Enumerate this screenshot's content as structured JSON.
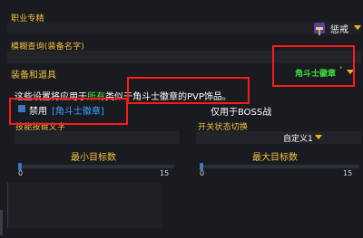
{
  "specialization": {
    "label": "职业专精",
    "value": "惩戒",
    "icon": "hammer-icon"
  },
  "fuzzy_search": {
    "label": "模糊查询(装备名字)",
    "value": ""
  },
  "equipment": {
    "label": "装备和道具",
    "selected": "角斗士徽章",
    "selected_color": "#3ee03e"
  },
  "description": {
    "part1": "这些设置将应用于",
    "highlight": "所有",
    "part2": "类似于角斗士徽章的PVP饰品。",
    "highlight_color": "#3ee03e"
  },
  "disable": {
    "label": "禁用",
    "item": "[角斗士徽章]",
    "item_color": "#3fa0ff"
  },
  "boss_only": {
    "label": "仅用于BOSS战"
  },
  "ability_text": {
    "label": "技能按键文字"
  },
  "toggle_switch": {
    "label": "开关状态切换",
    "value": "自定义1"
  },
  "min_targets": {
    "label": "最小目标数",
    "min": "0",
    "max": "15",
    "value": 0
  },
  "max_targets": {
    "label": "最大目标数",
    "min": "0",
    "max": "15",
    "value": 0
  },
  "colors": {
    "accent": "#f0c040",
    "annotation": "#ff1a1a"
  }
}
